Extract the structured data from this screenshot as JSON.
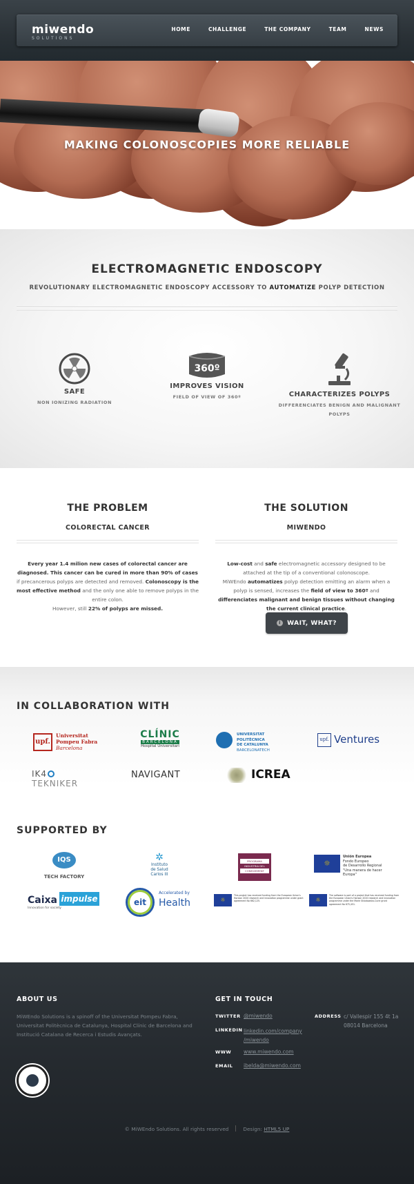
{
  "header": {
    "logo_text": "miwendo",
    "logo_sub": "SOLUTIONS",
    "nav": [
      "HOME",
      "CHALLENGE",
      "THE COMPANY",
      "TEAM",
      "NEWS"
    ]
  },
  "hero": {
    "title": "MAKING COLONOSCOPIES MORE RELIABLE"
  },
  "intro": {
    "title": "ELECTROMAGNETIC ENDOSCOPY",
    "subtitle_pre": "REVOLUTIONARY ELECTROMAGNETIC ENDOSCOPY ACCESSORY TO ",
    "subtitle_bold": "AUTOMATIZE",
    "subtitle_post": " POLYP DETECTION",
    "features": [
      {
        "icon": "radiation-icon",
        "title": "SAFE",
        "desc": "NON IONIZING RADIATION"
      },
      {
        "icon": "360-icon",
        "icon_text": "360º",
        "title": "IMPROVES VISION",
        "desc": "FIELD OF VIEW OF 360º"
      },
      {
        "icon": "microscope-icon",
        "title": "CHARACTERIZES POLYPS",
        "desc": "DIFFERENCIATES BENIGN AND MALIGNANT POLYPS"
      }
    ]
  },
  "problem": {
    "title": "THE PROBLEM",
    "subtitle": "COLORECTAL CANCER",
    "p1": "Every year 1.4 milion new cases of colorectal cancer are diagnosed. This cancer can be cured in more than 90% of cases",
    "p2": " if precancerous polyps are detected and removed. ",
    "p3": "Colonoscopy is the most effective method",
    "p4": " and the only one able to remove polyps in the entire colon.",
    "p5": "However, still ",
    "p6": "22% of polyps are missed."
  },
  "solution": {
    "title": "THE SOLUTION",
    "subtitle": "MIWENDO",
    "s1": "Low-cost",
    "s2": " and ",
    "s3": "safe",
    "s4": " electromagnetic accessory designed to be attached at the tip of a conventional colonoscope.",
    "s5": "MiWEndo ",
    "s6": "automatizes",
    "s7": " polyp detection emitting an alarm when a polyp is sensed, increases the ",
    "s8": "field of view to 360º",
    "s9": " and ",
    "s10": "differenciates malignant and benign tissues without changing the current clinical practice",
    "s11": ".",
    "button": "WAIT, WHAT?"
  },
  "collab": {
    "title": "IN COLLABORATION WITH",
    "upf1": "Universitat",
    "upf2": "Pompeu Fabra",
    "upf3": "Barcelona",
    "clinic1": "CLÍNIC",
    "clinic2": "BARCELONA",
    "clinic3": "Hospital Universitari",
    "upc1": "UNIVERSITAT POLITÈCNICA",
    "upc2": "DE CATALUNYA",
    "upc3": "BARCELONATECH",
    "upfv": "upf.",
    "ventures": "Ventures",
    "ik4": "IK4",
    "tekniker": "TEKNIKER",
    "navigant": "NAVIGANT",
    "icrea": "ICREA"
  },
  "support": {
    "title": "SUPPORTED BY",
    "iqs": "IQS",
    "iqs_sub": "TECH FACTORY",
    "isc1": "Instituto",
    "isc2": "de Salud",
    "isc3": "Carlos III",
    "prog1": "PROGRAMA",
    "prog2": "INDUSTRIA DEL",
    "prog3": "CONEIXEMENT",
    "ue1": "Unión Europea",
    "ue2": "Fondo Europeo",
    "ue3": "de Desarrollo Regional",
    "ue4": "\"Una manera de hacer Europa\"",
    "caixa": "Caixa",
    "impulse": "impulse",
    "caixa_sub": "Innovation for society",
    "eit": "eit",
    "eit_acc": "Accelerated by",
    "eit_h": "Health",
    "h2020a": "This project has received funding from the European Union's Horizon 2020 research and innovation programme under grant agreement No 662,125.",
    "h2020b": "The software is part of a project that has received funding from the European Union's Horizon 2020 research and innovation programme under the Marie Sklodowska-Curie grant agreement No 675,451."
  },
  "footer": {
    "about_title": "ABOUT US",
    "about_text": "MiWEndo Solutions is a spinoff of the Universitat Pompeu Fabra, Universitat Politècnica de Catalunya, Hospital Clínic de Barcelona and Institució Catalana de Recerca i Estudis Avançats.",
    "contact_title": "GET IN TOUCH",
    "twitter_label": "TWITTER",
    "twitter": "@miwendo",
    "linkedin_label": "LINKEDIN",
    "linkedin1": "linkedin.com/company",
    "linkedin2": "/miwendo",
    "www_label": "WWW",
    "www": "www.miwendo.com",
    "email_label": "EMAIL",
    "email": "ibelda@miwendo.com",
    "address_label": "ADDRESS",
    "address1": "c/ Vallespir 155 4t 1a",
    "address2": "08014 Barcelona",
    "copyright": "© MiWEndo Solutions. All rights reserved",
    "design_label": "Design: ",
    "design_link": "HTML5 UP"
  }
}
